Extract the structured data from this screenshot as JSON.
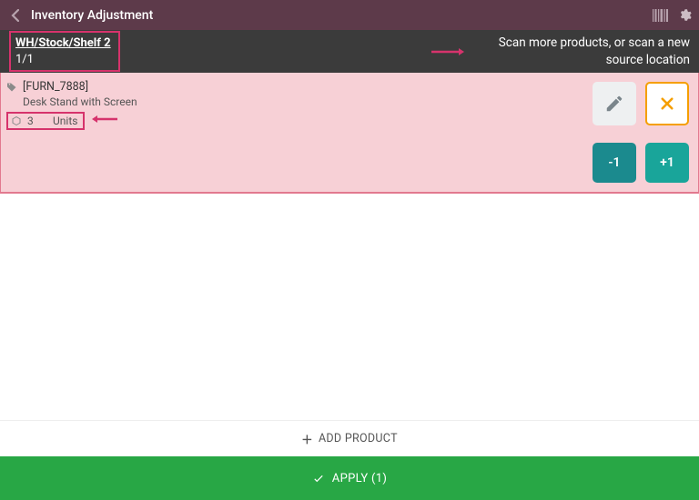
{
  "header": {
    "title": "Inventory Adjustment"
  },
  "location": {
    "path": "WH/Stock/Shelf 2",
    "count": "1/1",
    "hint": "Scan more products, or scan a new source location"
  },
  "product": {
    "sku": "[FURN_7888]",
    "name": "Desk Stand with Screen",
    "qty": "3",
    "uom": "Units"
  },
  "buttons": {
    "minus": "-1",
    "plus": "+1",
    "add_product": "ADD PRODUCT",
    "apply": "APPLY (1)"
  }
}
